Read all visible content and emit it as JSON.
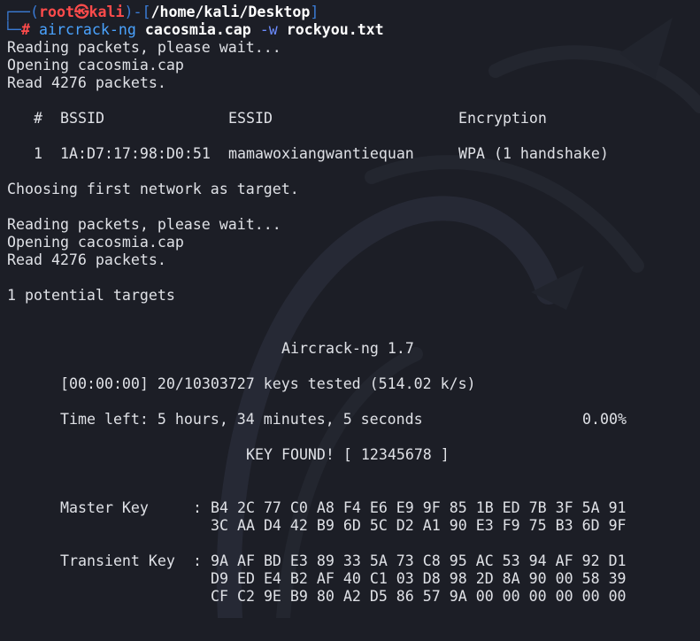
{
  "prompt": {
    "corner_top": "┌──(",
    "user": "root",
    "skull": "㉿",
    "host": "kali",
    "close_paren": ")-[",
    "path": "/home/kali/Desktop",
    "close_bracket": "]",
    "corner_bottom": "└─",
    "hash": "#"
  },
  "command": {
    "program": "aircrack-ng",
    "capture_file": "cacosmia.cap",
    "wordlist_flag": "-w",
    "wordlist": "rockyou.txt"
  },
  "output": {
    "reading1": "Reading packets, please wait...",
    "opening1": "Opening cacosmia.cap",
    "read1": "Read 4276 packets.",
    "header": {
      "num": "#",
      "bssid": "BSSID",
      "essid": "ESSID",
      "encryption": "Encryption"
    },
    "row": {
      "num": "1",
      "bssid": "1A:D7:17:98:D0:51",
      "essid": "mamawoxiangwantiequan",
      "encryption": "WPA (1 handshake)"
    },
    "choosing": "Choosing first network as target.",
    "reading2": "Reading packets, please wait...",
    "opening2": "Opening cacosmia.cap",
    "read2": "Read 4276 packets.",
    "targets": "1 potential targets",
    "title": "Aircrack-ng 1.7",
    "progress": "[00:00:00] 20/10303727 keys tested (514.02 k/s)",
    "time_left": "Time left: 5 hours, 34 minutes, 5 seconds",
    "percent": "0.00%",
    "key_found": "KEY FOUND! [ 12345678 ]",
    "master_key_label": "Master Key",
    "master_key_lines": [
      "B4 2C 77 C0 A8 F4 E6 E9 9F 85 1B ED 7B 3F 5A 91",
      "3C AA D4 42 B9 6D 5C D2 A1 90 E3 F9 75 B3 6D 9F"
    ],
    "transient_key_label": "Transient Key",
    "transient_key_lines": [
      "9A AF BD E3 89 33 5A 73 C8 95 AC 53 94 AF 92 D1",
      "D9 ED E4 B2 AF 40 C1 03 D8 98 2D 8A 90 00 58 39",
      "CF C2 9E B9 80 A2 D5 86 57 9A 00 00 00 00 00 00"
    ],
    "colon": ":"
  },
  "colors": {
    "background": "#1c1e26",
    "text": "#dfe1e6",
    "prompt_blue": "#3a7bd5",
    "prompt_red": "#ff4b4b"
  }
}
